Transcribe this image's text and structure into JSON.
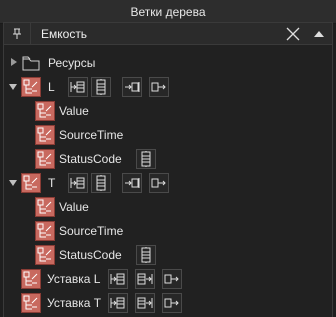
{
  "window": {
    "title": "Ветки дерева"
  },
  "toolbar": {
    "title": "Емкость",
    "pin_icon": "pin-icon",
    "close_icon": "close-icon",
    "collapse_icon": "triangle-up-icon"
  },
  "tree": {
    "resources": {
      "label": "Ресурсы",
      "icon": "folder-icon"
    },
    "L": {
      "label": "L",
      "children": {
        "value": "Value",
        "source_time": "SourceTime",
        "status_code": "StatusCode"
      }
    },
    "T": {
      "label": "T",
      "children": {
        "value": "Value",
        "source_time": "SourceTime",
        "status_code": "StatusCode"
      }
    },
    "setpoint_L": {
      "label": "Уставка L"
    },
    "setpoint_T": {
      "label": "Уставка T"
    }
  },
  "colors": {
    "node_icon_bg": "#c8695f",
    "background": "#1e1e1e",
    "panel": "#212121"
  }
}
